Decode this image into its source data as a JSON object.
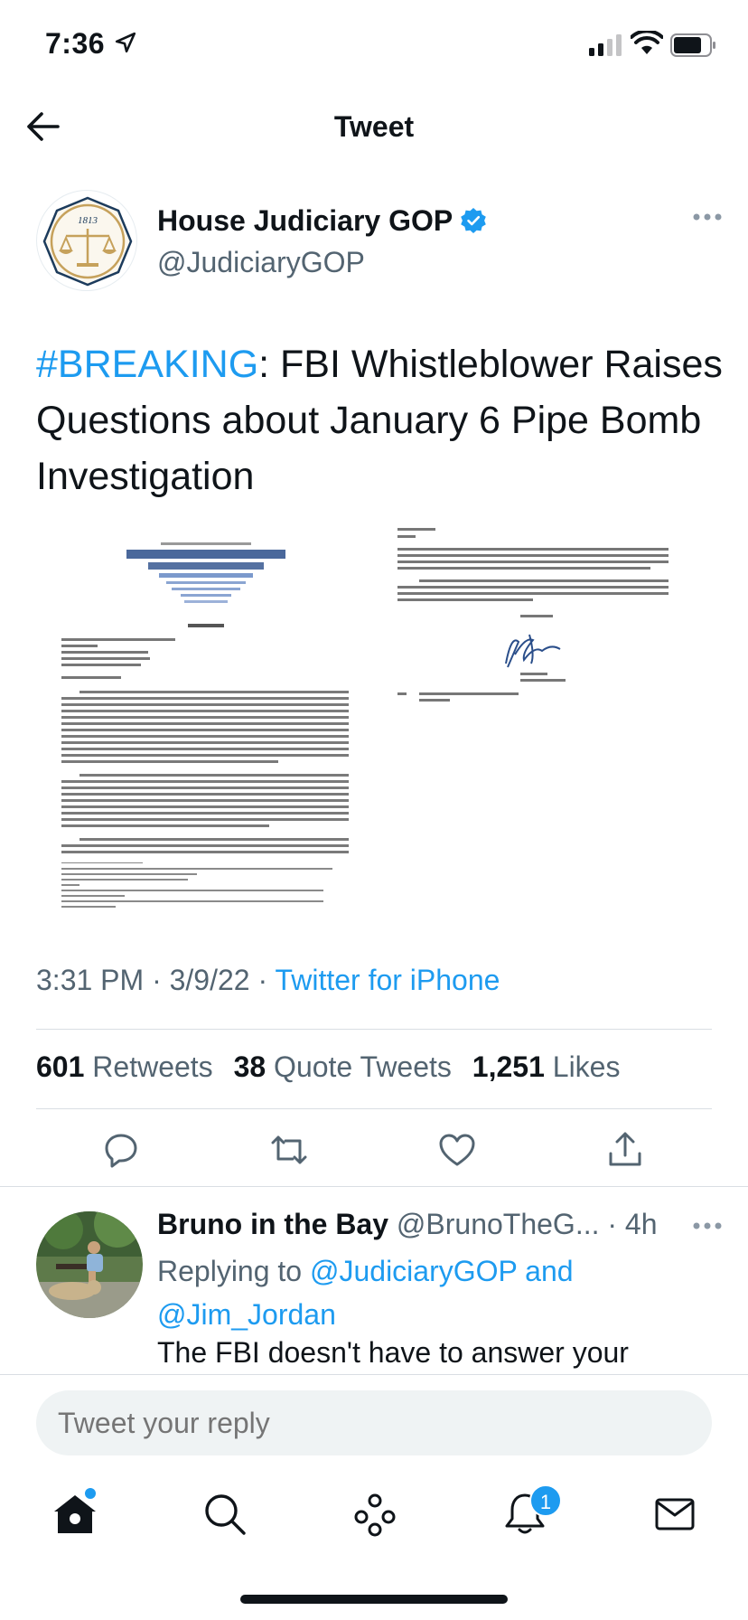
{
  "status_bar": {
    "time": "7:36"
  },
  "nav": {
    "title": "Tweet"
  },
  "author": {
    "name": "House Judiciary GOP",
    "handle": "@JudiciaryGOP",
    "avatar_year": "1813"
  },
  "tweet": {
    "hashtag": "#BREAKING",
    "text": ": FBI Whistleblower Raises Questions about January 6 Pipe Bomb Investigation",
    "timestamp": "3:31 PM · 3/9/22 · ",
    "source": "Twitter for iPhone"
  },
  "stats": {
    "retweets_count": "601",
    "retweets_label": "Retweets",
    "quotes_count": "38",
    "quotes_label": "Quote Tweets",
    "likes_count": "1,251",
    "likes_label": "Likes"
  },
  "reply": {
    "name": "Bruno in the Bay",
    "handle": "@BrunoTheG...",
    "time": " · 4h",
    "replying_prefix": "Replying to ",
    "mention_1": "@JudiciaryGOP and",
    "mention_2": "@Jim_Jordan",
    "body": "The FBI doesn't have to answer your"
  },
  "reply_bar": {
    "placeholder": "Tweet your reply"
  },
  "tabbar": {
    "notifications_badge": "1"
  },
  "colors": {
    "accent": "#1d9bf0",
    "text": "#0f1419",
    "secondary": "#536471"
  }
}
